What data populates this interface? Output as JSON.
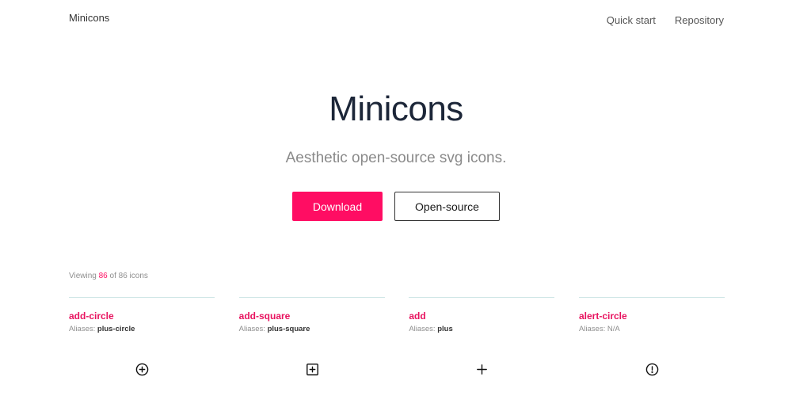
{
  "nav": {
    "brand": "Minicons",
    "links": [
      "Quick start",
      "Repository"
    ]
  },
  "hero": {
    "title": "Minicons",
    "subtitle": "Aesthetic open-source svg icons.",
    "download_label": "Download",
    "opensource_label": "Open-source"
  },
  "viewing": {
    "prefix": "Viewing",
    "shown": "86",
    "middle": "of 86 icons"
  },
  "icons": [
    {
      "name": "add-circle",
      "aliases_label": "Aliases:",
      "aliases": "plus-circle",
      "icon": "add-circle-icon"
    },
    {
      "name": "add-square",
      "aliases_label": "Aliases:",
      "aliases": "plus-square",
      "icon": "add-square-icon"
    },
    {
      "name": "add",
      "aliases_label": "Aliases:",
      "aliases": "plus",
      "icon": "add-icon"
    },
    {
      "name": "alert-circle",
      "aliases_label": "Aliases:",
      "aliases": "N/A",
      "icon": "alert-circle-icon"
    }
  ],
  "colors": {
    "accent": "#ff0d63",
    "title": "#1c2638",
    "muted": "#8a8a8a",
    "divider": "#cfe6e6"
  }
}
